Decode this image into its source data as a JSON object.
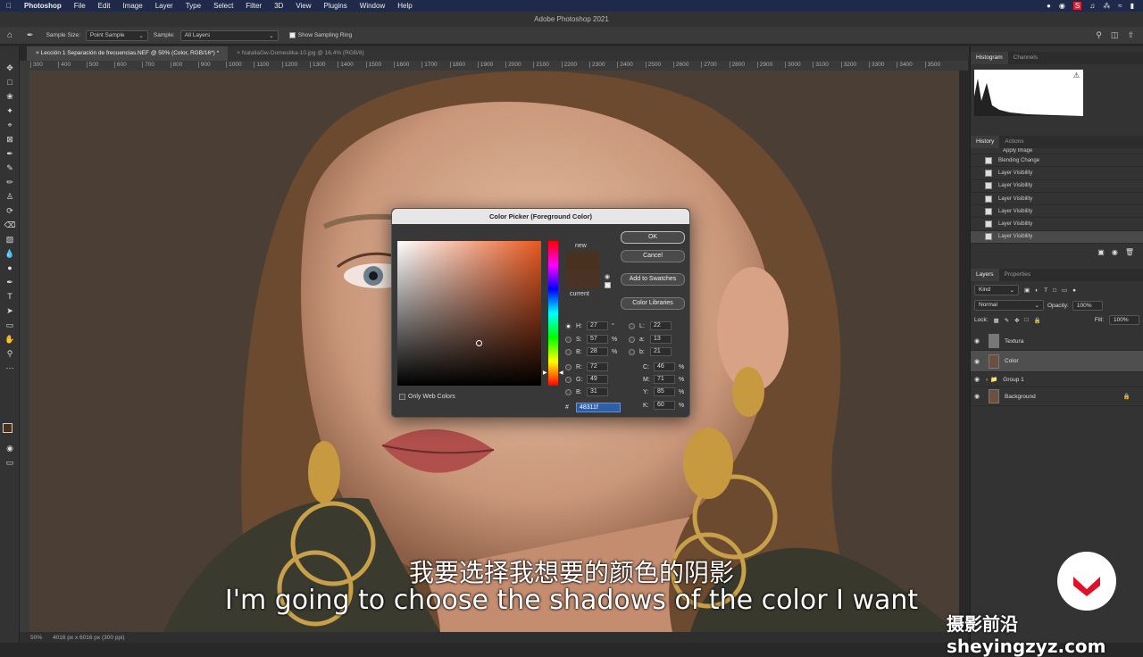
{
  "menubar": {
    "app": "Photoshop",
    "items": [
      "File",
      "Edit",
      "Image",
      "Layer",
      "Type",
      "Select",
      "Filter",
      "3D",
      "View",
      "Plugins",
      "Window",
      "Help"
    ]
  },
  "window_title": "Adobe Photoshop 2021",
  "options": {
    "sample_size_label": "Sample Size:",
    "sample_size_value": "Point Sample",
    "sample_label": "Sample:",
    "sample_value": "All Layers",
    "show_ring_label": "Show Sampling Ring"
  },
  "doc_tabs": [
    "Lección 1 Separación de frecuencias.NEF @ 50% (Color, RGB/16*) *",
    "NataliaGw-Domestika-10.jpg @ 16,4% (RGB/8)"
  ],
  "ruler_ticks": [
    "300",
    "400",
    "500",
    "600",
    "700",
    "800",
    "900",
    "1000",
    "1100",
    "1200",
    "1300",
    "1400",
    "1500",
    "1600",
    "1700",
    "1800",
    "1900",
    "2000",
    "2100",
    "2200",
    "2300",
    "2400",
    "2500",
    "2600",
    "2700",
    "2800",
    "2900",
    "3000",
    "3100",
    "3200",
    "3300",
    "3400",
    "3500"
  ],
  "status": {
    "zoom": "50%",
    "doc_size": "4016 px x 6016 px (300 ppi)"
  },
  "panels": {
    "histogram_tabs": [
      "Histogram",
      "Channels"
    ],
    "history_tabs": [
      "History",
      "Actions"
    ],
    "history_items": [
      "Apply Image",
      "Blending Change",
      "Layer Visibility",
      "Layer Visibility",
      "Layer Visibility",
      "Layer Visibility",
      "Layer Visibility",
      "Layer Visibility"
    ],
    "layers_tabs": [
      "Layers",
      "Properties"
    ],
    "kind_label": "Kind",
    "blend_mode": "Normal",
    "opacity_label": "Opacity:",
    "opacity_value": "100%",
    "lock_label": "Lock:",
    "fill_label": "Fill:",
    "fill_value": "100%",
    "layers": [
      {
        "name": "Textura",
        "visible": true
      },
      {
        "name": "Color",
        "visible": true
      },
      {
        "name": "Group 1",
        "visible": true
      },
      {
        "name": "Background",
        "visible": true
      }
    ]
  },
  "dialog": {
    "title": "Color Picker (Foreground Color)",
    "new_label": "new",
    "current_label": "current",
    "new_color": "#48311f",
    "current_color": "#4a3224",
    "ok": "OK",
    "cancel": "Cancel",
    "add_swatches": "Add to Swatches",
    "color_libraries": "Color Libraries",
    "only_web": "Only Web Colors",
    "H": "27",
    "S": "57",
    "Bv": "28",
    "R": "72",
    "G": "49",
    "Bb": "31",
    "L": "22",
    "a": "13",
    "b": "21",
    "C": "46",
    "M": "71",
    "Y": "85",
    "K": "60",
    "hex": "48311f",
    "deg": "°",
    "pct": "%"
  },
  "subtitle_cn": "我要选择我想要的颜色的阴影",
  "subtitle_en": "I'm going to choose the shadows of the color I want",
  "watermark": "摄影前沿 sheyingzyz.com"
}
